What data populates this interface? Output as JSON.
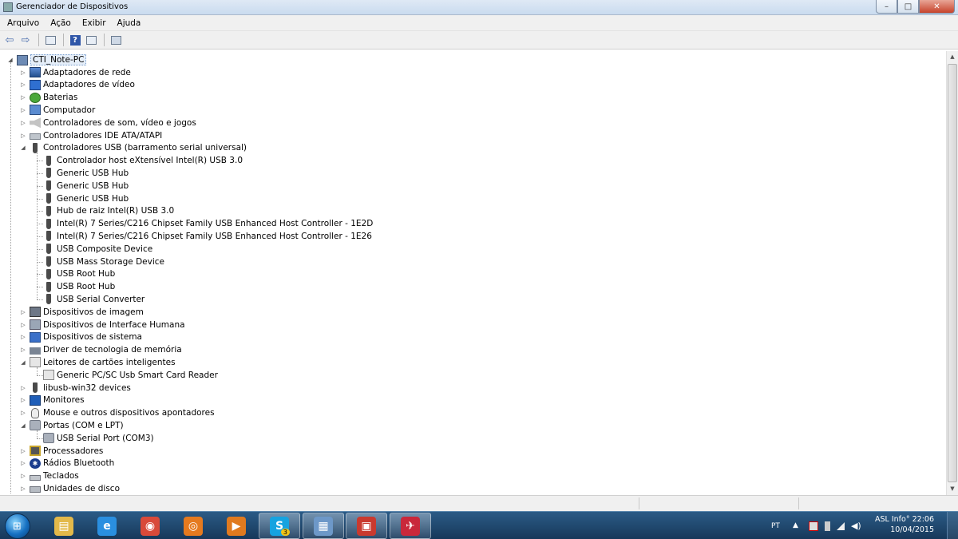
{
  "window": {
    "title": "Gerenciador de Dispositivos",
    "controls": {
      "minimize": "–",
      "maximize": "□",
      "close": "✕"
    }
  },
  "menu": [
    "Arquivo",
    "Ação",
    "Exibir",
    "Ajuda"
  ],
  "toolbar": {
    "back_icon": "back-arrow-icon",
    "forward_icon": "forward-arrow-icon",
    "help_label": "?"
  },
  "tree": {
    "root": "CTI_Note-PC",
    "items": [
      {
        "label": "Adaptadores de rede",
        "icon": "network-adapter-icon",
        "level": 1,
        "expander": "▷"
      },
      {
        "label": "Adaptadores de vídeo",
        "icon": "display-adapter-icon",
        "level": 1,
        "expander": "▷"
      },
      {
        "label": "Baterias",
        "icon": "battery-icon",
        "level": 1,
        "expander": "▷"
      },
      {
        "label": "Computador",
        "icon": "computer-icon",
        "level": 1,
        "expander": "▷"
      },
      {
        "label": "Controladores de som, vídeo e jogos",
        "icon": "sound-icon",
        "level": 1,
        "expander": "▷"
      },
      {
        "label": "Controladores IDE ATA/ATAPI",
        "icon": "ide-controller-icon",
        "level": 1,
        "expander": "▷"
      },
      {
        "label": "Controladores USB (barramento serial universal)",
        "icon": "usb-icon",
        "level": 1,
        "expander": "◢"
      },
      {
        "label": "Controlador host eXtensível Intel(R) USB 3.0",
        "icon": "usb-icon",
        "level": 2,
        "expander": ""
      },
      {
        "label": "Generic USB Hub",
        "icon": "usb-icon",
        "level": 2,
        "expander": ""
      },
      {
        "label": "Generic USB Hub",
        "icon": "usb-icon",
        "level": 2,
        "expander": ""
      },
      {
        "label": "Generic USB Hub",
        "icon": "usb-icon",
        "level": 2,
        "expander": ""
      },
      {
        "label": "Hub de raiz Intel(R) USB 3.0",
        "icon": "usb-icon",
        "level": 2,
        "expander": ""
      },
      {
        "label": "Intel(R) 7 Series/C216 Chipset Family USB Enhanced Host Controller - 1E2D",
        "icon": "usb-icon",
        "level": 2,
        "expander": ""
      },
      {
        "label": "Intel(R) 7 Series/C216 Chipset Family USB Enhanced Host Controller - 1E26",
        "icon": "usb-icon",
        "level": 2,
        "expander": ""
      },
      {
        "label": "USB Composite Device",
        "icon": "usb-icon",
        "level": 2,
        "expander": ""
      },
      {
        "label": "USB Mass Storage Device",
        "icon": "usb-icon",
        "level": 2,
        "expander": ""
      },
      {
        "label": "USB Root Hub",
        "icon": "usb-icon",
        "level": 2,
        "expander": ""
      },
      {
        "label": "USB Root Hub",
        "icon": "usb-icon",
        "level": 2,
        "expander": ""
      },
      {
        "label": "USB Serial Converter",
        "icon": "usb-icon",
        "level": 2,
        "expander": ""
      },
      {
        "label": "Dispositivos de imagem",
        "icon": "camera-icon",
        "level": 1,
        "expander": "▷"
      },
      {
        "label": "Dispositivos de Interface Humana",
        "icon": "hid-icon",
        "level": 1,
        "expander": "▷"
      },
      {
        "label": "Dispositivos de sistema",
        "icon": "system-device-icon",
        "level": 1,
        "expander": "▷"
      },
      {
        "label": "Driver de tecnologia de memória",
        "icon": "memory-icon",
        "level": 1,
        "expander": "▷"
      },
      {
        "label": "Leitores de cartões inteligentes",
        "icon": "smart-card-icon",
        "level": 1,
        "expander": "◢"
      },
      {
        "label": "Generic PC/SC Usb Smart Card Reader",
        "icon": "smart-card-icon",
        "level": 2,
        "expander": ""
      },
      {
        "label": "libusb-win32 devices",
        "icon": "usb-icon",
        "level": 1,
        "expander": "▷"
      },
      {
        "label": "Monitores",
        "icon": "monitor-icon",
        "level": 1,
        "expander": "▷"
      },
      {
        "label": "Mouse e outros dispositivos apontadores",
        "icon": "mouse-icon",
        "level": 1,
        "expander": "▷"
      },
      {
        "label": "Portas (COM e LPT)",
        "icon": "port-icon",
        "level": 1,
        "expander": "◢"
      },
      {
        "label": "USB Serial Port (COM3)",
        "icon": "port-icon",
        "level": 2,
        "expander": ""
      },
      {
        "label": "Processadores",
        "icon": "processor-icon",
        "level": 1,
        "expander": "▷"
      },
      {
        "label": "Rádios Bluetooth",
        "icon": "bluetooth-icon",
        "level": 1,
        "expander": "▷"
      },
      {
        "label": "Teclados",
        "icon": "keyboard-icon",
        "level": 1,
        "expander": "▷"
      },
      {
        "label": "Unidades de disco",
        "icon": "disk-drive-icon",
        "level": 1,
        "expander": "▷"
      }
    ]
  },
  "taskbar": {
    "apps": [
      {
        "name": "file-explorer-app",
        "color": "#e3b94a",
        "glyph": "▤"
      },
      {
        "name": "internet-explorer-app",
        "color": "#2a8fe0",
        "glyph": "e"
      },
      {
        "name": "chrome-app",
        "color": "#d94a3a",
        "glyph": "◉"
      },
      {
        "name": "firefox-app",
        "color": "#e57a1f",
        "glyph": "◎"
      },
      {
        "name": "media-player-app",
        "color": "#e07a1f",
        "glyph": "▶"
      },
      {
        "name": "skype-app",
        "color": "#16a3e0",
        "glyph": "S"
      },
      {
        "name": "control-panel-app",
        "color": "#6d98c8",
        "glyph": "▦"
      },
      {
        "name": "toolbox-app",
        "color": "#c93a2f",
        "glyph": "▣"
      },
      {
        "name": "asl-app",
        "color": "#c9283b",
        "glyph": "✈"
      }
    ],
    "language": "PT",
    "tray_label": "ASL Info°",
    "time": "22:06",
    "date": "10/04/2015",
    "skype_badge": "3"
  }
}
